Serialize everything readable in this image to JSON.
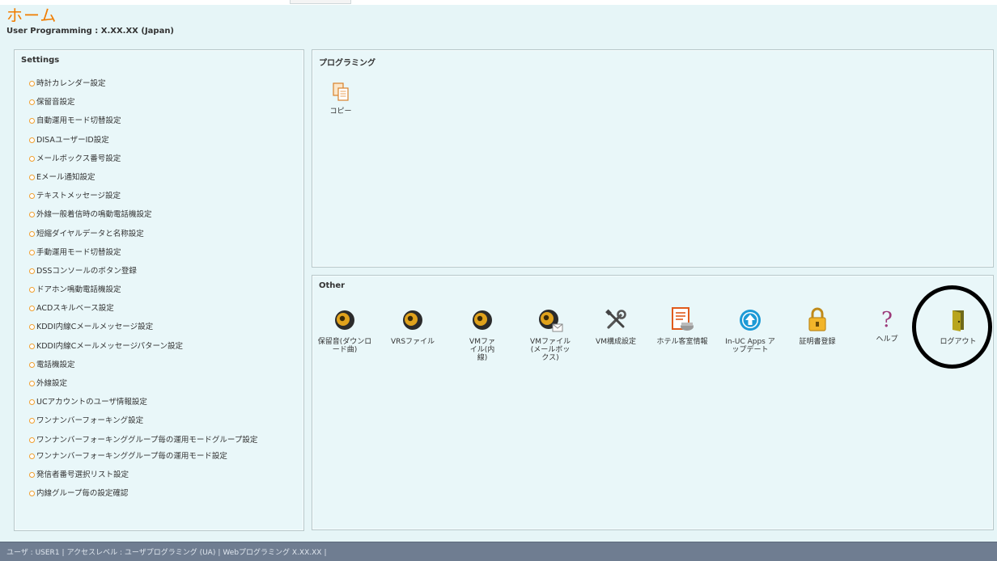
{
  "header": {
    "title": "ホーム",
    "subtitle": "User Programming : X.XX.XX (Japan)"
  },
  "settings": {
    "title": "Settings",
    "items": [
      "時計カレンダー設定",
      "保留音設定",
      "自動運用モード切替設定",
      "DISAユーザーID設定",
      "メールボックス番号設定",
      "Eメール通知設定",
      "テキストメッセージ設定",
      "外線一般着信時の鳴動電話機設定",
      "短縮ダイヤルデータと名称設定",
      "手動運用モード切替設定",
      "DSSコンソールのボタン登録",
      "ドアホン鳴動電話機設定",
      "ACDスキルベース設定",
      "KDDI内線Cメールメッセージ設定",
      "KDDI内線Cメールメッセージパターン設定",
      "電話機設定",
      "外線設定",
      "UCアカウントのユーザ情報設定",
      "ワンナンバーフォーキング設定",
      "ワンナンバーフォーキンググループ毎の運用モードグループ設定",
      "ワンナンバーフォーキンググループ毎の運用モード設定",
      "発信者番号選択リスト設定",
      "内線グループ毎の設定確認"
    ]
  },
  "programming": {
    "title": "プログラミング",
    "items": [
      {
        "label": "コピー",
        "icon": "copy-icon"
      }
    ]
  },
  "other": {
    "title": "Other",
    "items": [
      {
        "label": "保留音(ダウンロード曲)",
        "icon": "speaker-icon"
      },
      {
        "label": "VRSファイル",
        "icon": "speaker-icon"
      },
      {
        "label": "VMファイル(内線)",
        "icon": "speaker-icon"
      },
      {
        "label": "VMファイル(メールボックス)",
        "icon": "speaker-mail-icon"
      },
      {
        "label": "VM構成設定",
        "icon": "tools-icon"
      },
      {
        "label": "ホテル客室情報",
        "icon": "hotel-document-icon"
      },
      {
        "label": "In-UC Apps アップデート",
        "icon": "upload-icon"
      },
      {
        "label": "証明書登録",
        "icon": "lock-icon"
      },
      {
        "label": "ヘルプ",
        "icon": "help-icon"
      },
      {
        "label": "ログアウト",
        "icon": "door-icon"
      }
    ]
  },
  "statusbar": {
    "user": "ユーザ : USER1",
    "access_level": "アクセスレベル : ユーザプログラミング (UA)",
    "version": "Webプログラミング X.XX.XX"
  },
  "colors": {
    "title_orange": "#f07d00",
    "background": "#e6f5f7",
    "statusbar": "#6f7d91",
    "bullet": "#f0a030"
  }
}
